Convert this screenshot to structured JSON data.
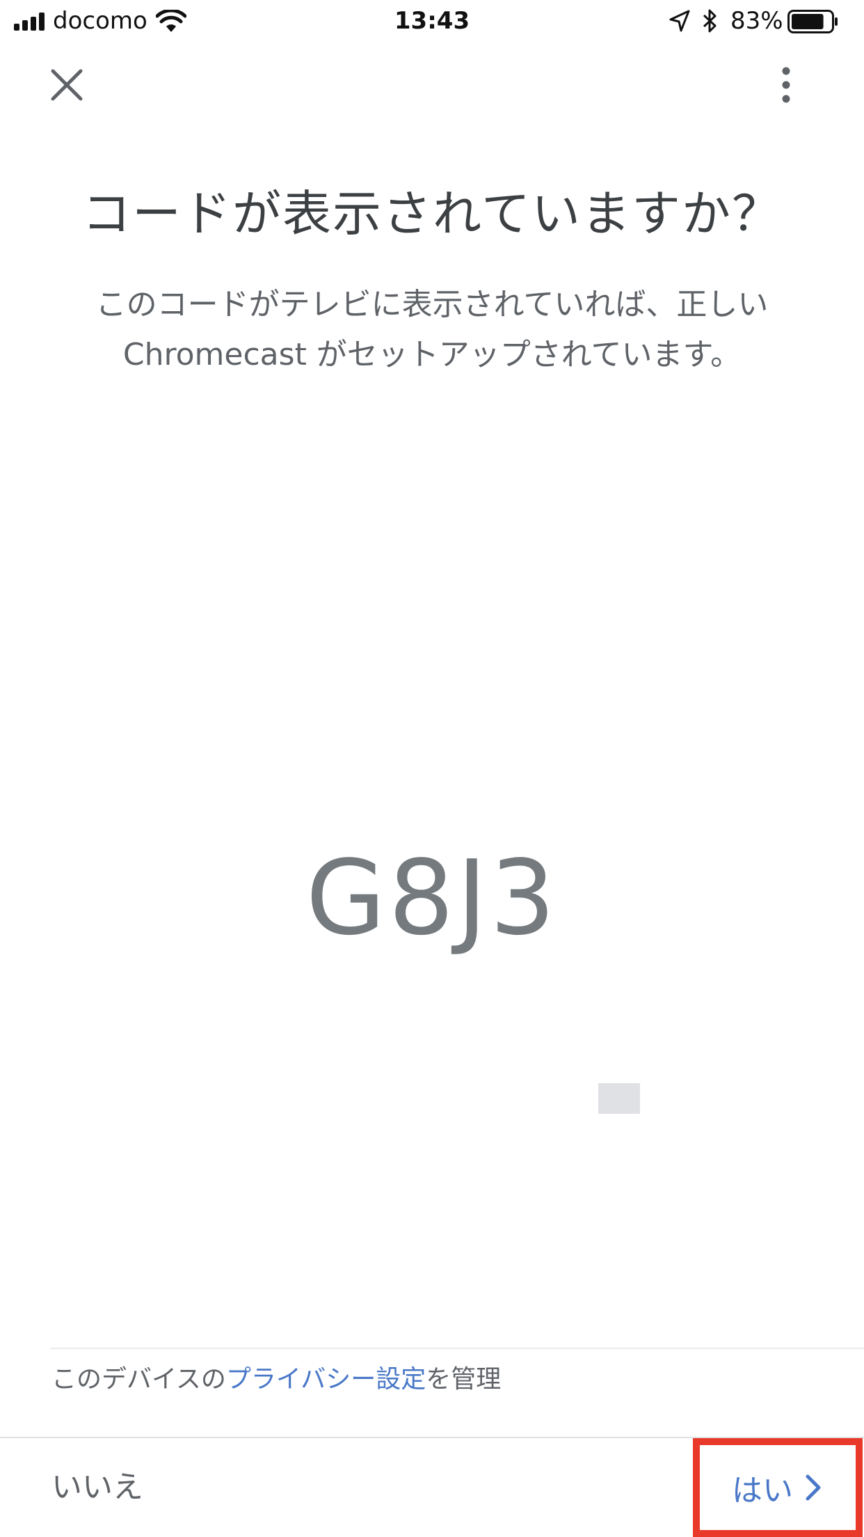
{
  "status_bar": {
    "carrier": "docomo",
    "time": "13:43",
    "battery_percent": "83%",
    "battery_level": 0.83,
    "icons": [
      "signal-icon",
      "wifi-icon",
      "location-icon",
      "bluetooth-icon",
      "battery-icon"
    ]
  },
  "top_bar": {
    "close_icon": "close-icon",
    "more_icon": "more-vertical-icon"
  },
  "main": {
    "title": "コードが表示されていますか？",
    "description_line1": "このコードがテレビに表示されていれば、正しい",
    "description_line2": "Chromecast がセットアップされています。",
    "code": "G8J3"
  },
  "privacy": {
    "prefix": "このデバイスの",
    "link": "プライバシー設定",
    "suffix": "を管理"
  },
  "actions": {
    "no_label": "いいえ",
    "yes_label": "はい"
  },
  "colors": {
    "link": "#4a78c8",
    "highlight": "#e8392b",
    "code_text": "#757a7e"
  }
}
